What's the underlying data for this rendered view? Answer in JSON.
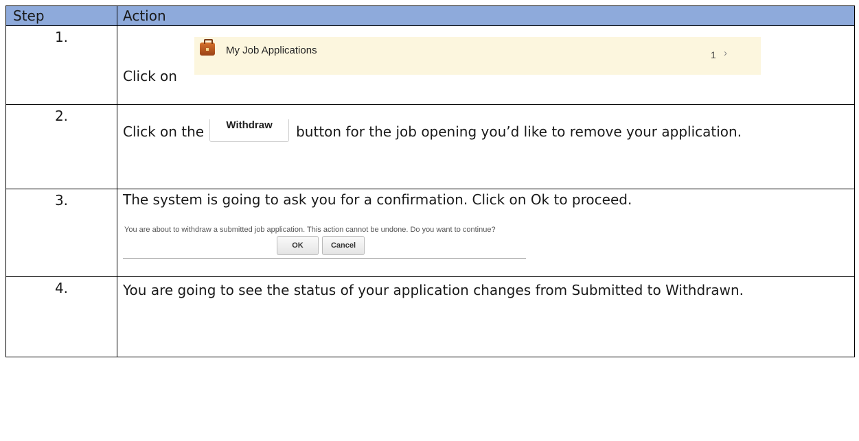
{
  "header": {
    "step": "Step",
    "action": "Action"
  },
  "rows": [
    {
      "step": "1.",
      "text_before": "Click on",
      "widget": {
        "label": "My Job Applications",
        "count": "1",
        "chevron": "›"
      }
    },
    {
      "step": "2.",
      "text_before": "Click on the",
      "button": "Withdraw",
      "text_after": "button for the job opening you’d like to remove your application."
    },
    {
      "step": "3.",
      "text": "The system is going to ask you for a confirmation. Click on Ok to proceed.",
      "dialog": {
        "message": "You are about to withdraw a submitted job application. This action cannot be undone. Do you want to continue?",
        "ok": "OK",
        "cancel": "Cancel"
      }
    },
    {
      "step": "4.",
      "text": "You are going to see the status of your application changes from Submitted to Withdrawn."
    }
  ],
  "icons": {
    "job_applications": "briefcase-icon",
    "chevron": "chevron-right-icon"
  },
  "colors": {
    "header_bg": "#8eaadb",
    "widget_bg": "#fcf6de"
  }
}
